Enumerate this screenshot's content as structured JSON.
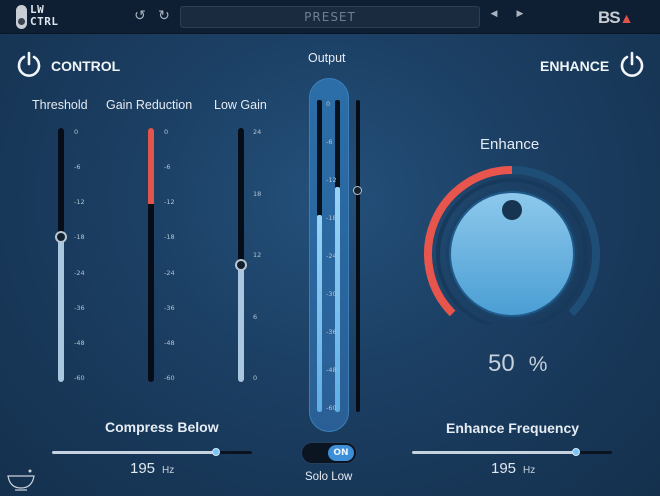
{
  "app": {
    "logo_line1": "LW",
    "logo_line2": "CTRL",
    "preset_label": "PRESET",
    "brand": "BS",
    "accent_color": "#e0544a",
    "highlight_color": "#5eaee6"
  },
  "toolbar": {
    "undo_icon": "undo-icon",
    "redo_icon": "redo-icon",
    "prev_icon": "prev-preset-icon",
    "next_icon": "next-preset-icon"
  },
  "control": {
    "title": "CONTROL",
    "threshold": {
      "label": "Threshold",
      "scale": [
        "0",
        "-6",
        "-12",
        "-18",
        "-24",
        "-36",
        "-48",
        "-60"
      ],
      "level_fraction": 0.57
    },
    "gain_reduction": {
      "label": "Gain Reduction",
      "scale": [
        "0",
        "-6",
        "-12",
        "-18",
        "-24",
        "-36",
        "-48",
        "-60"
      ],
      "reduction_fraction": 0.3
    },
    "low_gain": {
      "label": "Low Gain",
      "scale": [
        "24",
        "18",
        "12",
        "6",
        "0"
      ],
      "level_fraction": 0.46
    },
    "compress_below": {
      "label": "Compress Below",
      "value": "195",
      "unit": "Hz",
      "fraction": 0.82
    }
  },
  "output": {
    "label": "Output",
    "scale": [
      "0",
      "-6",
      "-12",
      "-18",
      "-24",
      "-30",
      "-36",
      "-48",
      "-60"
    ],
    "left_level_fraction": 0.63,
    "right_level_fraction": 0.72,
    "fader_fraction": 0.71,
    "solo_low_label": "Solo Low",
    "solo_state": "ON"
  },
  "enhance": {
    "title": "ENHANCE",
    "knob_label": "Enhance",
    "value": "50",
    "unit": "%",
    "fraction": 0.5,
    "frequency": {
      "label": "Enhance Frequency",
      "value": "195",
      "unit": "Hz",
      "fraction": 0.82
    }
  }
}
